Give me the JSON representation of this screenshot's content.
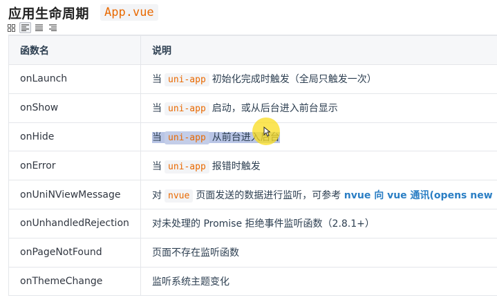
{
  "header": {
    "title": "应用生命周期",
    "code_title": "App.vue"
  },
  "toolbar": {
    "icons": [
      "grid-icon",
      "align-left-icon",
      "align-center-icon",
      "align-right-icon"
    ],
    "active_index": 1
  },
  "table": {
    "columns": [
      "函数名",
      "说明"
    ],
    "rows": [
      {
        "fn": "onLaunch",
        "parts": [
          [
            "t",
            "当"
          ],
          [
            "c",
            "uni-app"
          ],
          [
            "t",
            "初始化完成时触发（全局只触发一次）"
          ]
        ]
      },
      {
        "fn": "onShow",
        "parts": [
          [
            "t",
            "当"
          ],
          [
            "c",
            "uni-app"
          ],
          [
            "t",
            "启动，或从后台进入前台显示"
          ]
        ]
      },
      {
        "fn": "onHide",
        "parts": [
          [
            "t",
            "当"
          ],
          [
            "c",
            "uni-app"
          ],
          [
            "t",
            "从前台进入后台"
          ]
        ],
        "selected": true
      },
      {
        "fn": "onError",
        "parts": [
          [
            "t",
            "当"
          ],
          [
            "c",
            "uni-app"
          ],
          [
            "t",
            "报错时触发"
          ]
        ]
      },
      {
        "fn": "onUniNViewMessage",
        "parts": [
          [
            "t",
            "对"
          ],
          [
            "c",
            "nvue"
          ],
          [
            "t",
            "页面发送的数据进行监听，可参考 "
          ],
          [
            "l",
            "nvue 向 vue 通讯(opens new"
          ]
        ]
      },
      {
        "fn": "onUnhandledRejection",
        "parts": [
          [
            "t",
            "对未处理的 Promise 拒绝事件监听函数（2.8.1+）"
          ]
        ]
      },
      {
        "fn": "onPageNotFound",
        "parts": [
          [
            "t",
            "页面不存在监听函数"
          ]
        ]
      },
      {
        "fn": "onThemeChange",
        "parts": [
          [
            "t",
            "监听系统主题变化"
          ]
        ]
      }
    ]
  },
  "colors": {
    "code": "#e96900",
    "link": "#2a7ec4",
    "selection": "#b9c5e6",
    "cursor_highlight": "#fadc1e"
  }
}
